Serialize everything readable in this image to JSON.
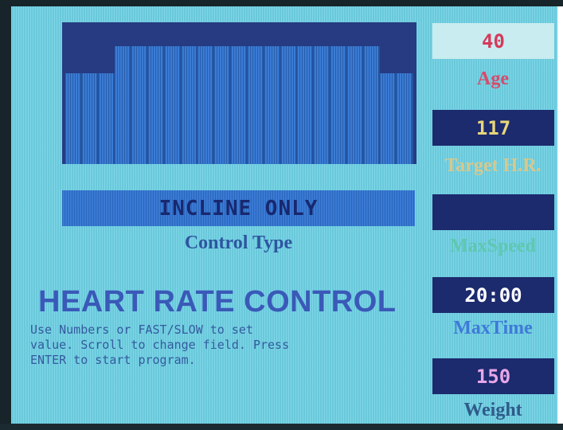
{
  "colors": {
    "age_value": "#d63a5c",
    "age_label": "#d84a6a",
    "target_hr_value": "#e6d67a",
    "target_hr_label": "#d6c88e",
    "max_speed_label": "#5fc7b0",
    "max_time_value": "#ffffff",
    "max_time_label": "#3f7ad8",
    "weight_value": "#e8a6e8",
    "weight_label": "#2f5a8a"
  },
  "profile": {
    "segment_levels": [
      0.77,
      0.77,
      0.77,
      1,
      1,
      1,
      1,
      1,
      1,
      1,
      1,
      1,
      1,
      1,
      1,
      1,
      1,
      1,
      1,
      0.77,
      0.77
    ]
  },
  "control": {
    "value": "INCLINE ONLY",
    "label": "Control Type"
  },
  "main": {
    "heading": "HEART RATE CONTROL",
    "instructions": [
      "Use Numbers or FAST/SLOW to set",
      "value. Scroll to change field. Press",
      "ENTER to start program."
    ]
  },
  "fields": {
    "age": {
      "value": "40",
      "label": "Age"
    },
    "target_hr": {
      "value": "117",
      "label": "Target H.R."
    },
    "max_speed": {
      "value": "",
      "label": "MaxSpeed"
    },
    "max_time": {
      "value": "20:00",
      "label": "MaxTime"
    },
    "weight": {
      "value": "150",
      "label": "Weight"
    }
  }
}
